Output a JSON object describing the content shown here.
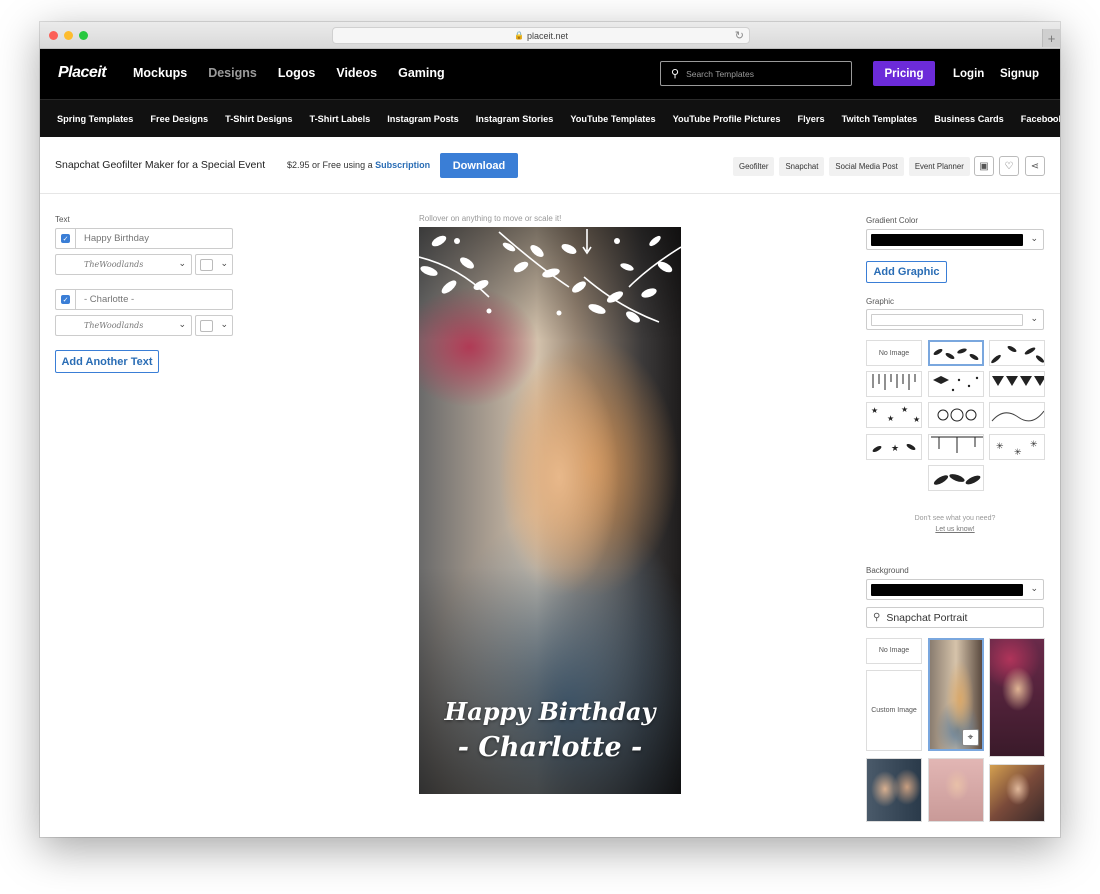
{
  "browser": {
    "url": "placeit.net",
    "new_tab": "+"
  },
  "nav": {
    "logo": "Placeit",
    "links": [
      "Mockups",
      "Designs",
      "Logos",
      "Videos",
      "Gaming"
    ],
    "search_placeholder": "Search Templates",
    "pricing": "Pricing",
    "login": "Login",
    "signup": "Signup"
  },
  "categories": [
    "Spring Templates",
    "Free Designs",
    "T-Shirt Designs",
    "T-Shirt Labels",
    "Instagram Posts",
    "Instagram Stories",
    "YouTube Templates",
    "YouTube Profile Pictures",
    "Flyers",
    "Twitch Templates",
    "Business Cards",
    "Facebook Posts"
  ],
  "titlebar": {
    "title": "Snapchat Geofilter Maker for a Special Event",
    "price": "$2.95",
    "price_or": "or Free using a",
    "subscription": "Subscription",
    "download": "Download",
    "tags": [
      "Geofilter",
      "Snapchat",
      "Social Media Post",
      "Event Planner"
    ]
  },
  "left": {
    "section_label": "Text",
    "text1": "Happy Birthday",
    "text2": "- Charlotte -",
    "font_name": "TheWoodlands",
    "add_text": "Add Another Text"
  },
  "canvas": {
    "hint": "Rollover on anything to move or scale it!",
    "line1": "Happy Birthday",
    "line2": "- Charlotte -"
  },
  "right": {
    "gradient_label": "Gradient Color",
    "add_graphic": "Add Graphic",
    "graphic_label": "Graphic",
    "no_image": "No Image",
    "help_line1": "Don't see what you need?",
    "help_link": "Let us know!",
    "background_label": "Background",
    "bg_search_value": "Snapchat Portrait",
    "custom_image": "Custom Image"
  },
  "colors": {
    "pricing": "#6c2bd9",
    "accent": "#3a7ed6",
    "nav_bg": "#000000"
  }
}
